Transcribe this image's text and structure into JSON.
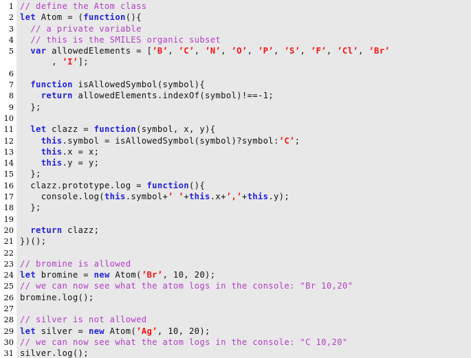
{
  "listing": {
    "language": "JavaScript",
    "colors": {
      "background": "#e8e8e8",
      "gutter_background": "#ffffff",
      "keyword": "#2222dd",
      "comment": "#b23fc4",
      "string": "#f51111",
      "plain": "#111111",
      "line_number": "#000000"
    },
    "line_numbers": [
      "1",
      "2",
      "3",
      "4",
      "5",
      "",
      "6",
      "7",
      "8",
      "9",
      "10",
      "11",
      "12",
      "13",
      "14",
      "15",
      "16",
      "17",
      "18",
      "19",
      "20",
      "21",
      "22",
      "23",
      "24",
      "25",
      "26",
      "27",
      "28",
      "29",
      "30",
      "31"
    ],
    "lines": [
      {
        "num": "1",
        "tokens": [
          {
            "t": "comment",
            "v": "// define the Atom class"
          }
        ]
      },
      {
        "num": "2",
        "tokens": [
          {
            "t": "keyword",
            "v": "let"
          },
          {
            "t": "plain",
            "v": " Atom = ("
          },
          {
            "t": "keyword",
            "v": "function"
          },
          {
            "t": "plain",
            "v": "(){"
          }
        ]
      },
      {
        "num": "3",
        "tokens": [
          {
            "t": "plain",
            "v": "  "
          },
          {
            "t": "comment",
            "v": "// a private variable"
          }
        ]
      },
      {
        "num": "4",
        "tokens": [
          {
            "t": "plain",
            "v": "  "
          },
          {
            "t": "comment",
            "v": "// this is the SMILES organic subset"
          }
        ]
      },
      {
        "num": "5",
        "tokens": [
          {
            "t": "plain",
            "v": "  "
          },
          {
            "t": "keyword",
            "v": "var"
          },
          {
            "t": "plain",
            "v": " allowedElements = ["
          },
          {
            "t": "string",
            "v": "’B’"
          },
          {
            "t": "plain",
            "v": ", "
          },
          {
            "t": "string",
            "v": "’C’"
          },
          {
            "t": "plain",
            "v": ", "
          },
          {
            "t": "string",
            "v": "’N’"
          },
          {
            "t": "plain",
            "v": ", "
          },
          {
            "t": "string",
            "v": "’O’"
          },
          {
            "t": "plain",
            "v": ", "
          },
          {
            "t": "string",
            "v": "’P’"
          },
          {
            "t": "plain",
            "v": ", "
          },
          {
            "t": "string",
            "v": "’S’"
          },
          {
            "t": "plain",
            "v": ", "
          },
          {
            "t": "string",
            "v": "’F’"
          },
          {
            "t": "plain",
            "v": ", "
          },
          {
            "t": "string",
            "v": "’Cl’"
          },
          {
            "t": "plain",
            "v": ", "
          },
          {
            "t": "string",
            "v": "’Br’"
          }
        ]
      },
      {
        "num": "",
        "tokens": [
          {
            "t": "plain",
            "v": "      , "
          },
          {
            "t": "string",
            "v": "’I’"
          },
          {
            "t": "plain",
            "v": "];"
          }
        ]
      },
      {
        "num": "6",
        "tokens": []
      },
      {
        "num": "7",
        "tokens": [
          {
            "t": "plain",
            "v": "  "
          },
          {
            "t": "keyword",
            "v": "function"
          },
          {
            "t": "plain",
            "v": " isAllowedSymbol(symbol){"
          }
        ]
      },
      {
        "num": "8",
        "tokens": [
          {
            "t": "plain",
            "v": "    "
          },
          {
            "t": "keyword",
            "v": "return"
          },
          {
            "t": "plain",
            "v": " allowedElements.indexOf(symbol)!==-1;"
          }
        ]
      },
      {
        "num": "9",
        "tokens": [
          {
            "t": "plain",
            "v": "  };"
          }
        ]
      },
      {
        "num": "10",
        "tokens": []
      },
      {
        "num": "11",
        "tokens": [
          {
            "t": "plain",
            "v": "  "
          },
          {
            "t": "keyword",
            "v": "let"
          },
          {
            "t": "plain",
            "v": " clazz = "
          },
          {
            "t": "keyword",
            "v": "function"
          },
          {
            "t": "plain",
            "v": "(symbol, x, y){"
          }
        ]
      },
      {
        "num": "12",
        "tokens": [
          {
            "t": "plain",
            "v": "    "
          },
          {
            "t": "keyword",
            "v": "this"
          },
          {
            "t": "plain",
            "v": ".symbol = isAllowedSymbol(symbol)?symbol:"
          },
          {
            "t": "string",
            "v": "’C’"
          },
          {
            "t": "plain",
            "v": ";"
          }
        ]
      },
      {
        "num": "13",
        "tokens": [
          {
            "t": "plain",
            "v": "    "
          },
          {
            "t": "keyword",
            "v": "this"
          },
          {
            "t": "plain",
            "v": ".x = x;"
          }
        ]
      },
      {
        "num": "14",
        "tokens": [
          {
            "t": "plain",
            "v": "    "
          },
          {
            "t": "keyword",
            "v": "this"
          },
          {
            "t": "plain",
            "v": ".y = y;"
          }
        ]
      },
      {
        "num": "15",
        "tokens": [
          {
            "t": "plain",
            "v": "  };"
          }
        ]
      },
      {
        "num": "16",
        "tokens": [
          {
            "t": "plain",
            "v": "  clazz.prototype.log = "
          },
          {
            "t": "keyword",
            "v": "function"
          },
          {
            "t": "plain",
            "v": "(){"
          }
        ]
      },
      {
        "num": "17",
        "tokens": [
          {
            "t": "plain",
            "v": "    console.log("
          },
          {
            "t": "keyword",
            "v": "this"
          },
          {
            "t": "plain",
            "v": ".symbol+"
          },
          {
            "t": "string",
            "v": "’ ’"
          },
          {
            "t": "plain",
            "v": "+"
          },
          {
            "t": "keyword",
            "v": "this"
          },
          {
            "t": "plain",
            "v": ".x+"
          },
          {
            "t": "string",
            "v": "’,’"
          },
          {
            "t": "plain",
            "v": "+"
          },
          {
            "t": "keyword",
            "v": "this"
          },
          {
            "t": "plain",
            "v": ".y);"
          }
        ]
      },
      {
        "num": "18",
        "tokens": [
          {
            "t": "plain",
            "v": "  };"
          }
        ]
      },
      {
        "num": "19",
        "tokens": []
      },
      {
        "num": "20",
        "tokens": [
          {
            "t": "plain",
            "v": "  "
          },
          {
            "t": "keyword",
            "v": "return"
          },
          {
            "t": "plain",
            "v": " clazz;"
          }
        ]
      },
      {
        "num": "21",
        "tokens": [
          {
            "t": "plain",
            "v": "})();"
          }
        ]
      },
      {
        "num": "22",
        "tokens": []
      },
      {
        "num": "23",
        "tokens": [
          {
            "t": "comment",
            "v": "// bromine is allowed"
          }
        ]
      },
      {
        "num": "24",
        "tokens": [
          {
            "t": "keyword",
            "v": "let"
          },
          {
            "t": "plain",
            "v": " bromine = "
          },
          {
            "t": "keyword",
            "v": "new"
          },
          {
            "t": "plain",
            "v": " Atom("
          },
          {
            "t": "string",
            "v": "’Br’"
          },
          {
            "t": "plain",
            "v": ", 10, 20);"
          }
        ]
      },
      {
        "num": "25",
        "tokens": [
          {
            "t": "comment",
            "v": "// we can now see what the atom logs in the console: \"Br 10,20\""
          }
        ]
      },
      {
        "num": "26",
        "tokens": [
          {
            "t": "plain",
            "v": "bromine.log();"
          }
        ]
      },
      {
        "num": "27",
        "tokens": []
      },
      {
        "num": "28",
        "tokens": [
          {
            "t": "comment",
            "v": "// silver is not allowed"
          }
        ]
      },
      {
        "num": "29",
        "tokens": [
          {
            "t": "keyword",
            "v": "let"
          },
          {
            "t": "plain",
            "v": " silver = "
          },
          {
            "t": "keyword",
            "v": "new"
          },
          {
            "t": "plain",
            "v": " Atom("
          },
          {
            "t": "string",
            "v": "’Ag’"
          },
          {
            "t": "plain",
            "v": ", 10, 20);"
          }
        ]
      },
      {
        "num": "30",
        "tokens": [
          {
            "t": "comment",
            "v": "// we can now see what the atom logs in the console: \"C 10,20\""
          }
        ]
      },
      {
        "num": "31",
        "tokens": [
          {
            "t": "plain",
            "v": "silver.log();"
          }
        ]
      }
    ]
  }
}
